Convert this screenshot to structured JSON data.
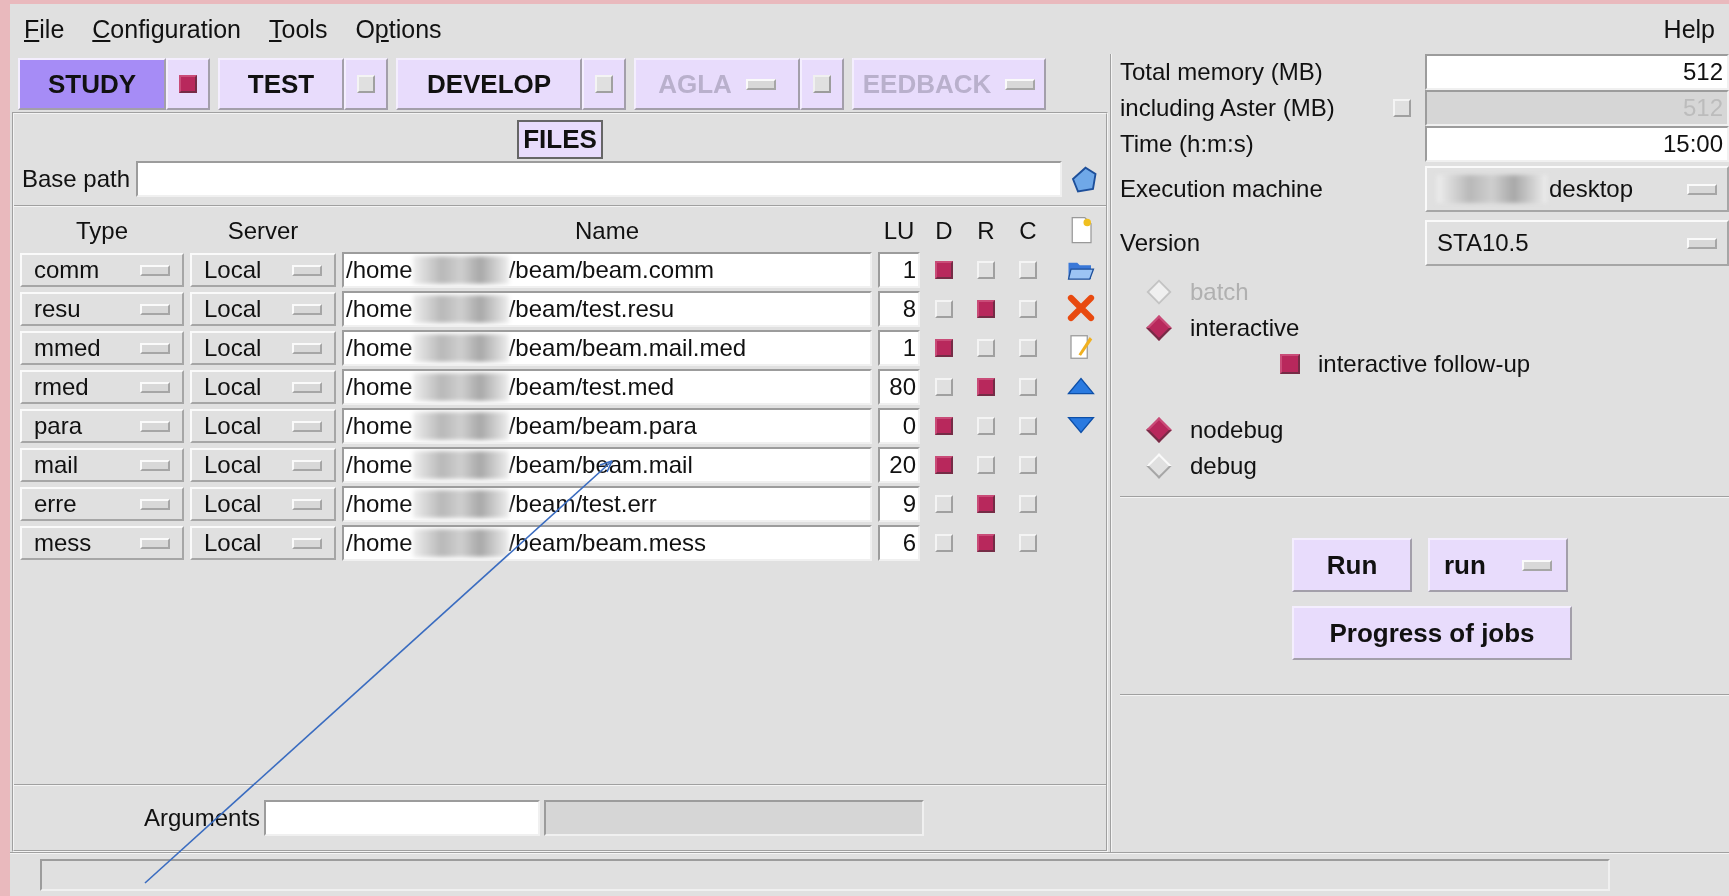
{
  "menu": [
    {
      "key": "F",
      "post": "ile"
    },
    {
      "key": "C",
      "post": "onfiguration"
    },
    {
      "key": "T",
      "post": "ools"
    },
    {
      "pre": "O",
      "key": "p",
      "post": "tions"
    }
  ],
  "help_menu": {
    "pre": "Help"
  },
  "modes": [
    {
      "label": "STUDY",
      "kind": "check",
      "selected": true,
      "checked": true,
      "disabled": false
    },
    {
      "label": "TEST",
      "kind": "check",
      "selected": false,
      "checked": false,
      "disabled": false
    },
    {
      "label": "DEVELOP",
      "kind": "check",
      "selected": false,
      "checked": false,
      "disabled": false
    },
    {
      "label": "AGLA",
      "kind": "dropcheck",
      "selected": false,
      "checked": false,
      "disabled": true
    },
    {
      "label": "EEDBACK",
      "kind": "drop",
      "selected": false,
      "disabled": true
    }
  ],
  "files_title": "FILES",
  "base_path": {
    "label": "Base path"
  },
  "table": {
    "columns": [
      "Type",
      "Server",
      "Name",
      "LU",
      "D",
      "R",
      "C"
    ],
    "rows": [
      {
        "type": "comm",
        "server": "Local",
        "dir": "/home",
        "file": "/beam/beam.comm",
        "lu": "1",
        "d": true,
        "r": false,
        "c": false
      },
      {
        "type": "resu",
        "server": "Local",
        "dir": "/home",
        "file": "/beam/test.resu",
        "lu": "8",
        "d": false,
        "r": true,
        "c": false
      },
      {
        "type": "mmed",
        "server": "Local",
        "dir": "/home",
        "file": "/beam/beam.mail.med",
        "lu": "1",
        "d": true,
        "r": false,
        "c": false
      },
      {
        "type": "rmed",
        "server": "Local",
        "dir": "/home",
        "file": "/beam/test.med",
        "lu": "80",
        "d": false,
        "r": true,
        "c": false
      },
      {
        "type": "para",
        "server": "Local",
        "dir": "/home",
        "file": "/beam/beam.para",
        "lu": "0",
        "d": true,
        "r": false,
        "c": false
      },
      {
        "type": "mail",
        "server": "Local",
        "dir": "/home",
        "file": "/beam/beam.mail",
        "lu": "20",
        "d": true,
        "r": false,
        "c": false
      },
      {
        "type": "erre",
        "server": "Local",
        "dir": "/home",
        "file": "/beam/test.err",
        "lu": "9",
        "d": false,
        "r": true,
        "c": false
      },
      {
        "type": "mess",
        "server": "Local",
        "dir": "/home",
        "file": "/beam/beam.mess",
        "lu": "6",
        "d": false,
        "r": true,
        "c": false
      }
    ]
  },
  "arguments": {
    "label": "Arguments"
  },
  "settings": {
    "total_memory": {
      "label": "Total memory (MB)",
      "value": "512"
    },
    "aster_memory": {
      "label": "including Aster (MB)",
      "checked": false,
      "value": "512",
      "disabled": true
    },
    "time": {
      "label": "Time (h:m:s)",
      "value": "15:00"
    },
    "machine": {
      "label": "Execution machine",
      "value": "desktop"
    },
    "version": {
      "label": "Version",
      "value": "STA10.5"
    }
  },
  "mode_radios": [
    {
      "label": "batch",
      "selected": false,
      "disabled": true
    },
    {
      "label": "interactive",
      "selected": true,
      "disabled": false
    }
  ],
  "followup": {
    "label": "interactive follow-up",
    "checked": true
  },
  "debug_radios": [
    {
      "label": "nodebug",
      "selected": true,
      "disabled": false
    },
    {
      "label": "debug",
      "selected": false,
      "disabled": false
    }
  ],
  "run_button": "Run",
  "run_mode": "run",
  "progress_button": "Progress of jobs"
}
